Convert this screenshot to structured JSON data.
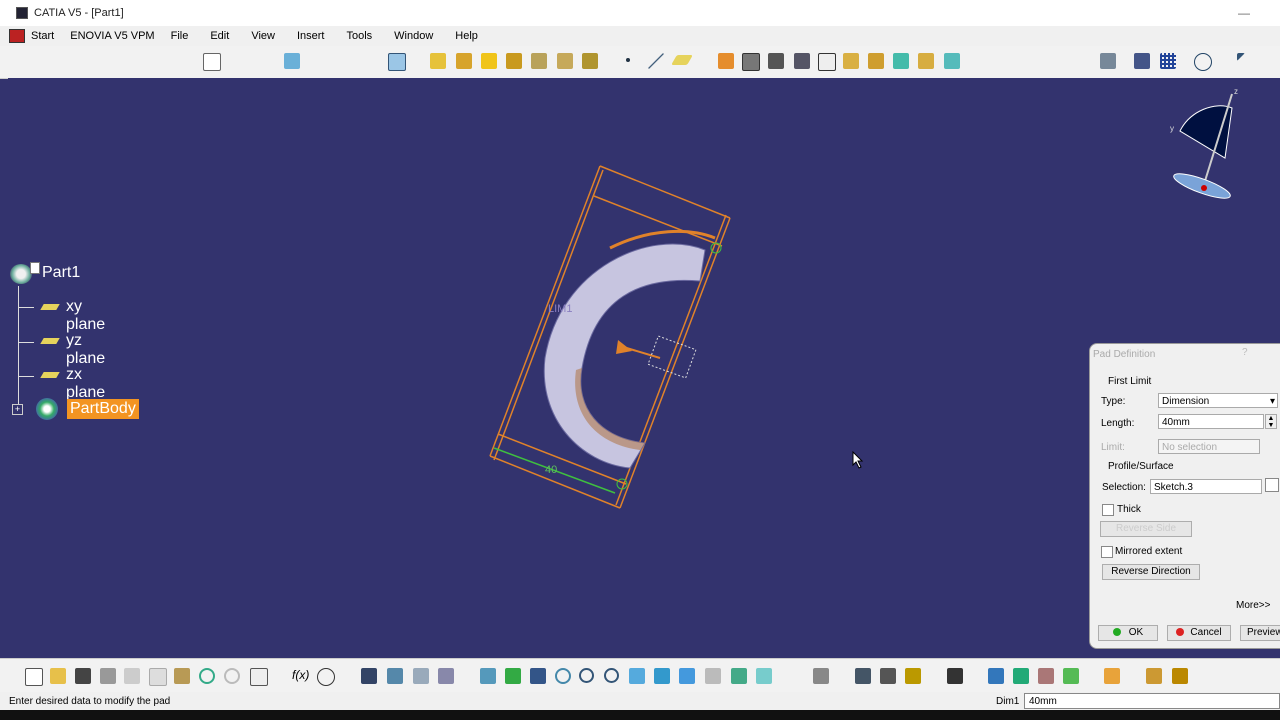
{
  "window": {
    "title": "CATIA V5 - [Part1]",
    "minimize": "—"
  },
  "menu": [
    "Start",
    "ENOVIA V5 VPM",
    "File",
    "Edit",
    "View",
    "Insert",
    "Tools",
    "Window",
    "Help"
  ],
  "tree": {
    "root": "Part1",
    "items": [
      "xy plane",
      "yz plane",
      "zx plane"
    ],
    "body": "PartBody"
  },
  "model": {
    "dim_label": "LIM1",
    "dim_value": "40"
  },
  "dialog": {
    "title": "Pad Definition",
    "help": "?",
    "first_limit": "First Limit",
    "type_label": "Type:",
    "type_value": "Dimension",
    "length_label": "Length:",
    "length_value": "40mm",
    "limit_label": "Limit:",
    "limit_value": "No selection",
    "profile": "Profile/Surface",
    "selection_label": "Selection:",
    "selection_value": "Sketch.3",
    "thick_label": "Thick",
    "reverse_side": "Reverse Side",
    "mirrored_label": "Mirrored extent",
    "reverse_direction": "Reverse Direction",
    "more": "More>>",
    "ok": "OK",
    "cancel": "Cancel",
    "preview": "Preview"
  },
  "status": {
    "message": "Enter desired data to modify the pad",
    "dim_label": "Dim1",
    "dim_value": "40mm"
  },
  "colors": {
    "background": "#33336e",
    "highlight": "#f39422",
    "model": "#c7c5e0"
  }
}
